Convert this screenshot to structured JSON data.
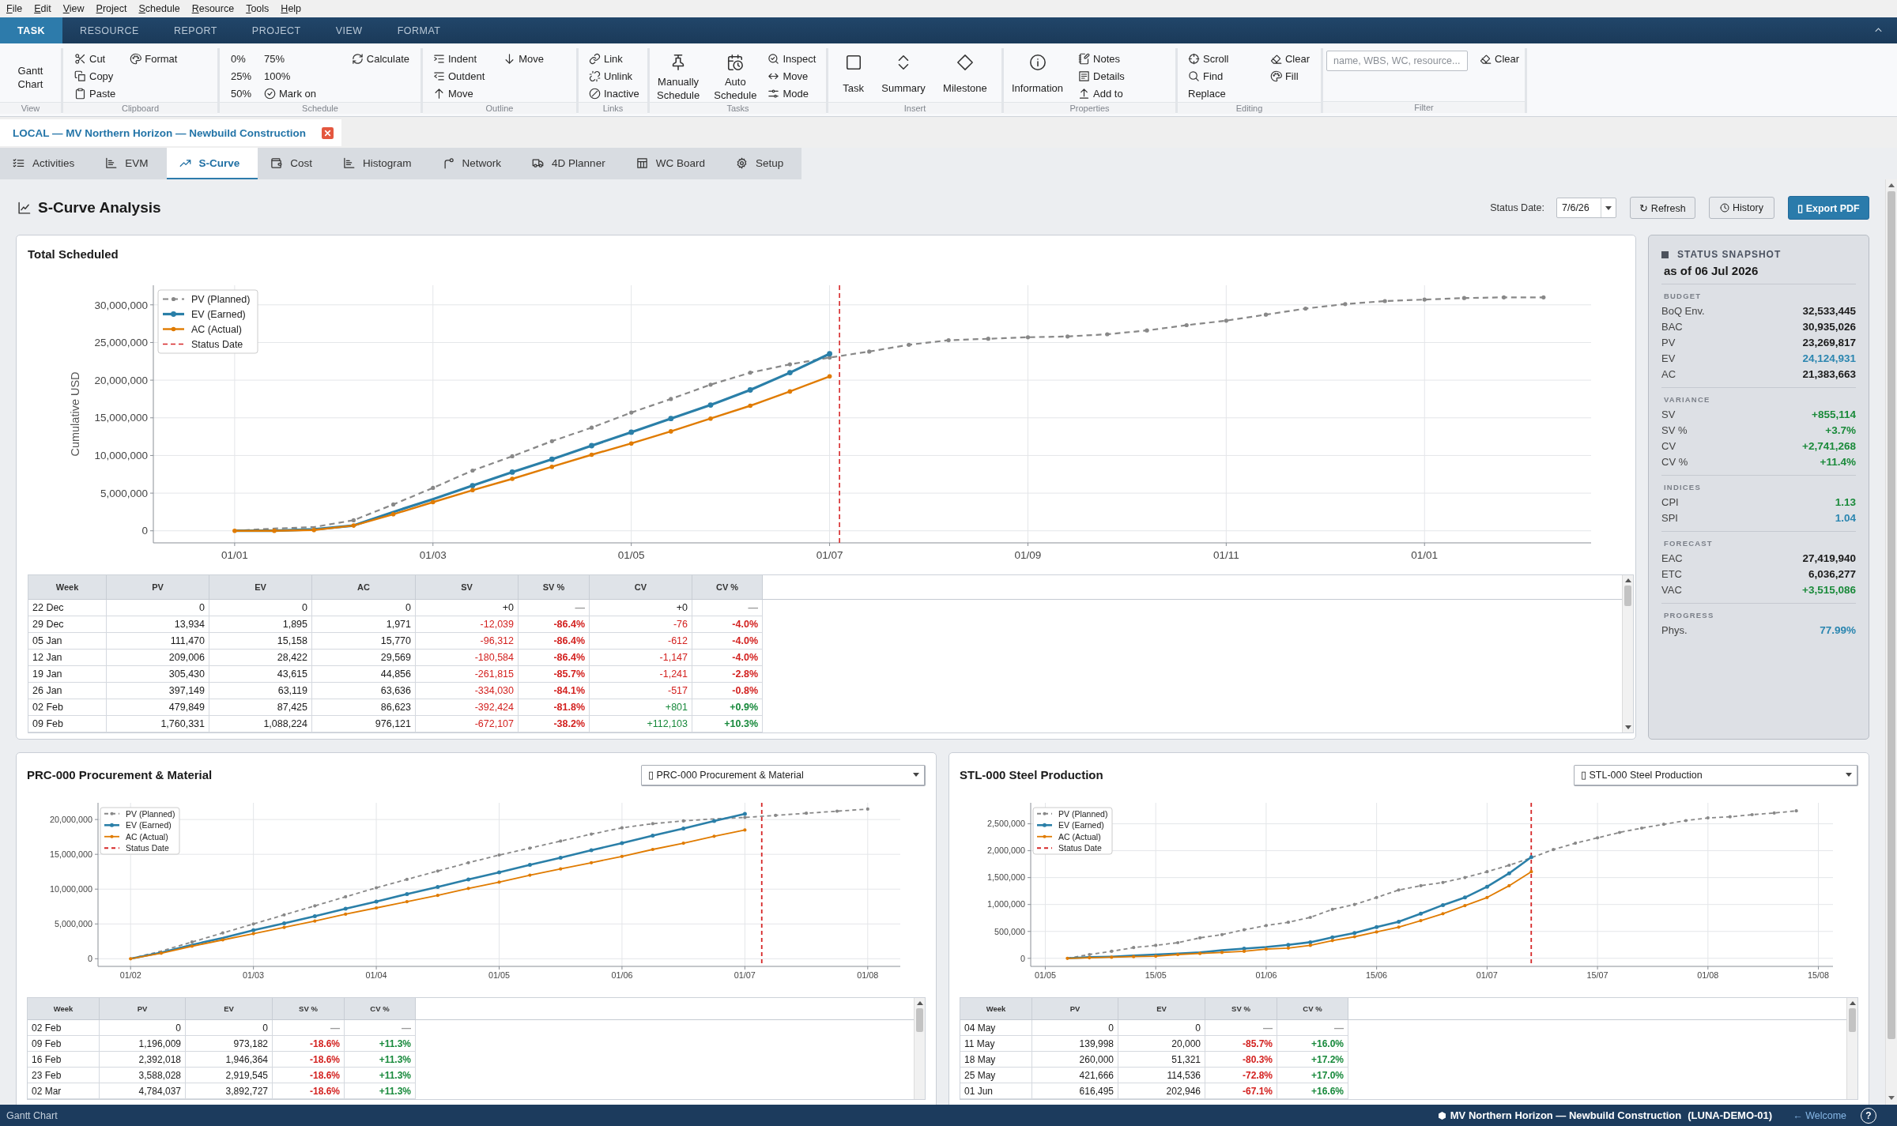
{
  "menu_bar": [
    "File",
    "Edit",
    "View",
    "Project",
    "Schedule",
    "Resource",
    "Tools",
    "Help"
  ],
  "ribbon": {
    "tabs": [
      {
        "label": "TASK",
        "selected": true
      },
      {
        "label": "RESOURCE",
        "selected": false
      },
      {
        "label": "REPORT",
        "selected": false
      },
      {
        "label": "PROJECT",
        "selected": false
      },
      {
        "label": "VIEW",
        "selected": false
      },
      {
        "label": "FORMAT",
        "selected": false
      }
    ],
    "groups": [
      {
        "label": "View",
        "columns": [
          [
            {
              "kind": "large",
              "label": "Gantt Chart"
            }
          ]
        ]
      },
      {
        "label": "Clipboard",
        "columns": [
          [
            {
              "kind": "small",
              "label": "Cut"
            },
            {
              "kind": "small",
              "label": "Copy"
            },
            {
              "kind": "small",
              "label": "Paste"
            }
          ],
          [
            {
              "kind": "small",
              "label": "Format"
            }
          ]
        ]
      },
      {
        "label": "Schedule",
        "columns": [
          [
            {
              "kind": "small",
              "label": "0%"
            },
            {
              "kind": "small",
              "label": "25%"
            },
            {
              "kind": "small",
              "label": "50%"
            }
          ],
          [
            {
              "kind": "small",
              "label": "75%"
            },
            {
              "kind": "small",
              "label": "100%"
            },
            {
              "kind": "small",
              "label": "Mark on"
            }
          ],
          [
            {
              "kind": "small",
              "label": "Calculate"
            }
          ]
        ]
      },
      {
        "label": "Outline",
        "columns": [
          [
            {
              "kind": "small",
              "label": "Indent"
            },
            {
              "kind": "small",
              "label": "Outdent"
            },
            {
              "kind": "small",
              "label": "Move"
            }
          ],
          [
            {
              "kind": "small",
              "label": "Move"
            }
          ]
        ]
      },
      {
        "label": "Links",
        "columns": [
          [
            {
              "kind": "small",
              "label": "Link"
            },
            {
              "kind": "small",
              "label": "Unlink"
            },
            {
              "kind": "small",
              "label": "Inactive"
            }
          ]
        ]
      },
      {
        "label": "Tasks",
        "columns": [
          [
            {
              "kind": "large",
              "label": "Manually Schedule"
            }
          ],
          [
            {
              "kind": "large",
              "label": "Auto Schedule"
            }
          ],
          [
            {
              "kind": "small",
              "label": "Inspect"
            },
            {
              "kind": "small",
              "label": "Move"
            },
            {
              "kind": "small",
              "label": "Mode"
            }
          ]
        ]
      },
      {
        "label": "Insert",
        "columns": [
          [
            {
              "kind": "large",
              "label": "Task"
            }
          ],
          [
            {
              "kind": "large",
              "label": "Summary"
            }
          ],
          [
            {
              "kind": "large",
              "label": "Milestone"
            }
          ]
        ]
      },
      {
        "label": "Properties",
        "columns": [
          [
            {
              "kind": "large",
              "label": "Information"
            }
          ],
          [
            {
              "kind": "small",
              "label": "Notes"
            },
            {
              "kind": "small",
              "label": "Details"
            },
            {
              "kind": "small",
              "label": "Add to"
            }
          ]
        ]
      },
      {
        "label": "Editing",
        "columns": [
          [
            {
              "kind": "small",
              "label": "Scroll"
            },
            {
              "kind": "small",
              "label": "Find"
            },
            {
              "kind": "small",
              "label": "Replace"
            }
          ],
          [
            {
              "kind": "small",
              "label": "Clear"
            },
            {
              "kind": "small",
              "label": "Fill"
            }
          ]
        ]
      },
      {
        "label": "Filter",
        "columns": [
          [
            {
              "kind": "field",
              "placeholder": "name, WBS, WC, resource..."
            }
          ],
          [
            {
              "kind": "small",
              "label": "Clear"
            }
          ]
        ]
      }
    ]
  },
  "document_tab": {
    "title": "LOCAL — MV Northern Horizon — Newbuild Construction"
  },
  "module_tabs": [
    {
      "label": "Activities",
      "selected": false
    },
    {
      "label": "EVM",
      "selected": false
    },
    {
      "label": "S-Curve",
      "selected": true
    },
    {
      "label": "Cost",
      "selected": false
    },
    {
      "label": "Histogram",
      "selected": false
    },
    {
      "label": "Network",
      "selected": false
    },
    {
      "label": "4D Planner",
      "selected": false
    },
    {
      "label": "WC Board",
      "selected": false
    },
    {
      "label": "Setup",
      "selected": false
    }
  ],
  "page_header": {
    "title": "S-Curve Analysis",
    "status_date_label": "Status Date:",
    "status_date": "7/6/26",
    "buttons": [
      {
        "label": "↻ Refresh",
        "kind": "secondary"
      },
      {
        "label": "History",
        "kind": "secondary"
      },
      {
        "label": "▯ Export PDF",
        "kind": "primary"
      }
    ]
  },
  "main_chart": {
    "title": "Total Scheduled",
    "status_line": {
      "label": "Status Date"
    },
    "chart_data": {
      "type": "line",
      "ylabel": "Cumulative USD",
      "categories": [
        "01/01",
        null,
        null,
        null,
        null,
        "01/03",
        null,
        null,
        null,
        null,
        "01/05",
        null,
        null,
        null,
        null,
        "01/07",
        null,
        null,
        null,
        null,
        "01/09",
        null,
        null,
        null,
        null,
        "01/11",
        null,
        null,
        null,
        null,
        "01/01",
        null,
        null,
        null
      ],
      "series": [
        {
          "name": "PV (Planned)",
          "color": "#888888",
          "line_style": "dashed",
          "values": [
            0,
            300000,
            500000,
            1400000,
            3500000,
            5700000,
            8000000,
            9900000,
            11900000,
            13700000,
            15700000,
            17500000,
            19400000,
            21000000,
            22100000,
            23000000,
            23800000,
            24700000,
            25300000,
            25500000,
            25700000,
            25800000,
            26100000,
            26600000,
            27300000,
            27900000,
            28700000,
            29500000,
            30100000,
            30500000,
            30700000,
            30900000,
            31000000,
            31000000
          ]
        },
        {
          "name": "EV (Earned)",
          "color": "#2a7fa8",
          "values": [
            0,
            0,
            200000,
            700000,
            2500000,
            4200000,
            6000000,
            7800000,
            9500000,
            11300000,
            13100000,
            14900000,
            16700000,
            18700000,
            21000000,
            23500000,
            null,
            null,
            null,
            null,
            null,
            null,
            null,
            null,
            null,
            null,
            null,
            null,
            null,
            null,
            null,
            null,
            null,
            null
          ]
        },
        {
          "name": "AC (Actual)",
          "color": "#e07b00",
          "values": [
            0,
            0,
            100000,
            700000,
            2200000,
            3800000,
            5400000,
            6900000,
            8500000,
            10100000,
            11600000,
            13200000,
            14900000,
            16600000,
            18500000,
            20500000,
            null,
            null,
            null,
            null,
            null,
            null,
            null,
            null,
            null,
            null,
            null,
            null,
            null,
            null,
            null,
            null,
            null,
            null
          ]
        }
      ],
      "ylim": [
        -1600000,
        32600000
      ],
      "yticks": [
        {
          "value": 0,
          "label": "0"
        },
        {
          "value": 5000000,
          "label": "5,000,000"
        },
        {
          "value": 10000000,
          "label": "10,000,000"
        },
        {
          "value": 15000000,
          "label": "15,000,000"
        },
        {
          "value": 20000000,
          "label": "20,000,000"
        },
        {
          "value": 25000000,
          "label": "25,000,000"
        },
        {
          "value": 30000000,
          "label": "30,000,000"
        }
      ],
      "grid": true,
      "legend": true
    },
    "table": {
      "columns": [
        {
          "label": "Week",
          "kind": "label"
        },
        {
          "label": "PV",
          "kind": "amount"
        },
        {
          "label": "EV",
          "kind": "amount"
        },
        {
          "label": "AC",
          "kind": "amount"
        },
        {
          "label": "SV",
          "kind": "variance"
        },
        {
          "label": "SV %",
          "kind": "percent"
        },
        {
          "label": "CV",
          "kind": "variance"
        },
        {
          "label": "CV %",
          "kind": "percent"
        }
      ],
      "rows": [
        {
          "cells": [
            {
              "text": "22 Dec",
              "kind": "plain"
            },
            {
              "text": "0",
              "kind": "plain"
            },
            {
              "text": "0",
              "kind": "plain"
            },
            {
              "text": "0",
              "kind": "plain"
            },
            {
              "text": "+0",
              "kind": "neutral"
            },
            {
              "text": "—",
              "kind": "neutral"
            },
            {
              "text": "+0",
              "kind": "neutral"
            },
            {
              "text": "—",
              "kind": "neutral"
            }
          ]
        },
        {
          "cells": [
            {
              "text": "29 Dec",
              "kind": "plain"
            },
            {
              "text": "13,934",
              "kind": "plain"
            },
            {
              "text": "1,895",
              "kind": "plain"
            },
            {
              "text": "1,971",
              "kind": "plain"
            },
            {
              "text": "-12,039",
              "kind": "negative"
            },
            {
              "text": "-86.4%",
              "kind": "negative"
            },
            {
              "text": "-76",
              "kind": "negative"
            },
            {
              "text": "-4.0%",
              "kind": "negative"
            }
          ]
        },
        {
          "cells": [
            {
              "text": "05 Jan",
              "kind": "plain"
            },
            {
              "text": "111,470",
              "kind": "plain"
            },
            {
              "text": "15,158",
              "kind": "plain"
            },
            {
              "text": "15,770",
              "kind": "plain"
            },
            {
              "text": "-96,312",
              "kind": "negative"
            },
            {
              "text": "-86.4%",
              "kind": "negative"
            },
            {
              "text": "-612",
              "kind": "negative"
            },
            {
              "text": "-4.0%",
              "kind": "negative"
            }
          ]
        },
        {
          "cells": [
            {
              "text": "12 Jan",
              "kind": "plain"
            },
            {
              "text": "209,006",
              "kind": "plain"
            },
            {
              "text": "28,422",
              "kind": "plain"
            },
            {
              "text": "29,569",
              "kind": "plain"
            },
            {
              "text": "-180,584",
              "kind": "negative"
            },
            {
              "text": "-86.4%",
              "kind": "negative"
            },
            {
              "text": "-1,147",
              "kind": "negative"
            },
            {
              "text": "-4.0%",
              "kind": "negative"
            }
          ]
        },
        {
          "cells": [
            {
              "text": "19 Jan",
              "kind": "plain"
            },
            {
              "text": "305,430",
              "kind": "plain"
            },
            {
              "text": "43,615",
              "kind": "plain"
            },
            {
              "text": "44,856",
              "kind": "plain"
            },
            {
              "text": "-261,815",
              "kind": "negative"
            },
            {
              "text": "-85.7%",
              "kind": "negative"
            },
            {
              "text": "-1,241",
              "kind": "negative"
            },
            {
              "text": "-2.8%",
              "kind": "negative"
            }
          ]
        },
        {
          "cells": [
            {
              "text": "26 Jan",
              "kind": "plain"
            },
            {
              "text": "397,149",
              "kind": "plain"
            },
            {
              "text": "63,119",
              "kind": "plain"
            },
            {
              "text": "63,636",
              "kind": "plain"
            },
            {
              "text": "-334,030",
              "kind": "negative"
            },
            {
              "text": "-84.1%",
              "kind": "negative"
            },
            {
              "text": "-517",
              "kind": "negative"
            },
            {
              "text": "-0.8%",
              "kind": "negative"
            }
          ]
        },
        {
          "cells": [
            {
              "text": "02 Feb",
              "kind": "plain"
            },
            {
              "text": "479,849",
              "kind": "plain"
            },
            {
              "text": "87,425",
              "kind": "plain"
            },
            {
              "text": "86,623",
              "kind": "plain"
            },
            {
              "text": "-392,424",
              "kind": "negative"
            },
            {
              "text": "-81.8%",
              "kind": "negative"
            },
            {
              "text": "+801",
              "kind": "positive"
            },
            {
              "text": "+0.9%",
              "kind": "positive"
            }
          ]
        },
        {
          "cells": [
            {
              "text": "09 Feb",
              "kind": "plain"
            },
            {
              "text": "1,760,331",
              "kind": "plain"
            },
            {
              "text": "1,088,224",
              "kind": "plain"
            },
            {
              "text": "976,121",
              "kind": "plain"
            },
            {
              "text": "-672,107",
              "kind": "negative"
            },
            {
              "text": "-38.2%",
              "kind": "negative"
            },
            {
              "text": "+112,103",
              "kind": "positive"
            },
            {
              "text": "+10.3%",
              "kind": "positive"
            }
          ]
        }
      ]
    }
  },
  "status_snapshot": {
    "title": "STATUS SNAPSHOT",
    "as_of": "as of 06 Jul 2026",
    "sections": [
      {
        "title": "BUDGET",
        "rows": [
          {
            "label": "BoQ Env.",
            "value": "32,533,445",
            "kind": "plain"
          },
          {
            "label": "BAC",
            "value": "30,935,026",
            "kind": "plain"
          },
          {
            "label": "PV",
            "value": "23,269,817",
            "kind": "plain"
          },
          {
            "label": "EV",
            "value": "24,124,931",
            "kind": "info"
          },
          {
            "label": "AC",
            "value": "21,383,663",
            "kind": "plain"
          }
        ]
      },
      {
        "title": "VARIANCE",
        "rows": [
          {
            "label": "SV",
            "value": "+855,114",
            "kind": "positive"
          },
          {
            "label": "SV %",
            "value": "+3.7%",
            "kind": "positive"
          },
          {
            "label": "CV",
            "value": "+2,741,268",
            "kind": "positive"
          },
          {
            "label": "CV %",
            "value": "+11.4%",
            "kind": "positive"
          }
        ]
      },
      {
        "title": "INDICES",
        "rows": [
          {
            "label": "CPI",
            "value": "1.13",
            "kind": "positive"
          },
          {
            "label": "SPI",
            "value": "1.04",
            "kind": "info"
          }
        ]
      },
      {
        "title": "FORECAST",
        "rows": [
          {
            "label": "EAC",
            "value": "27,419,940",
            "kind": "plain"
          },
          {
            "label": "ETC",
            "value": "6,036,277",
            "kind": "plain"
          },
          {
            "label": "VAC",
            "value": "+3,515,086",
            "kind": "positive"
          }
        ]
      },
      {
        "title": "PROGRESS",
        "rows": [
          {
            "label": "Phys.",
            "value": "77.99%",
            "kind": "info"
          }
        ]
      }
    ]
  },
  "wbs_panels": [
    {
      "title": "PRC-000 Procurement & Material",
      "selector": "▯ PRC-000 Procurement & Material",
      "status_line": {
        "label": "Status Date"
      },
      "chart_data": {
        "type": "line",
        "categories": [
          "01/02",
          null,
          null,
          null,
          "01/03",
          null,
          null,
          null,
          "01/04",
          null,
          null,
          null,
          "01/05",
          null,
          null,
          null,
          "01/06",
          null,
          null,
          null,
          "01/07",
          null,
          null,
          null,
          "01/08"
        ],
        "series": [
          {
            "name": "PV (Planned)",
            "color": "#888888",
            "line_style": "dashed",
            "values": [
              0,
              1100000,
              2400000,
              3700000,
              5000000,
              6300000,
              7600000,
              8900000,
              10200000,
              11400000,
              12600000,
              13800000,
              14900000,
              15900000,
              16900000,
              17900000,
              18800000,
              19400000,
              19800000,
              20100000,
              20300000,
              20600000,
              20900000,
              21200000,
              21500000
            ]
          },
          {
            "name": "EV (Earned)",
            "color": "#2a7fa8",
            "values": [
              0,
              900000,
              2000000,
              3000000,
              4100000,
              5100000,
              6100000,
              7200000,
              8200000,
              9300000,
              10300000,
              11400000,
              12400000,
              13500000,
              14500000,
              15600000,
              16600000,
              17700000,
              18700000,
              19800000,
              20800000,
              null,
              null,
              null,
              null
            ]
          },
          {
            "name": "AC (Actual)",
            "color": "#e07b00",
            "values": [
              0,
              800000,
              1800000,
              2700000,
              3600000,
              4500000,
              5400000,
              6400000,
              7300000,
              8200000,
              9100000,
              10100000,
              11000000,
              12000000,
              12900000,
              13800000,
              14700000,
              15700000,
              16600000,
              17600000,
              18500000,
              null,
              null,
              null,
              null
            ]
          }
        ],
        "ylim": [
          -1100000,
          22400000
        ],
        "yticks": [
          {
            "value": 0,
            "label": "0"
          },
          {
            "value": 5000000,
            "label": "5,000,000"
          },
          {
            "value": 10000000,
            "label": "10,000,000"
          },
          {
            "value": 15000000,
            "label": "15,000,000"
          },
          {
            "value": 20000000,
            "label": "20,000,000"
          }
        ],
        "grid": true,
        "legend": true
      },
      "table": {
        "columns": [
          {
            "label": "Week",
            "kind": "label"
          },
          {
            "label": "PV",
            "kind": "amount"
          },
          {
            "label": "EV",
            "kind": "amount"
          },
          {
            "label": "SV %",
            "kind": "percent"
          },
          {
            "label": "CV %",
            "kind": "percent"
          }
        ],
        "rows": [
          {
            "cells": [
              {
                "text": "02 Feb",
                "kind": "plain"
              },
              {
                "text": "0",
                "kind": "plain"
              },
              {
                "text": "0",
                "kind": "plain"
              },
              {
                "text": "—",
                "kind": "neutral"
              },
              {
                "text": "—",
                "kind": "neutral"
              }
            ]
          },
          {
            "cells": [
              {
                "text": "09 Feb",
                "kind": "plain"
              },
              {
                "text": "1,196,009",
                "kind": "plain"
              },
              {
                "text": "973,182",
                "kind": "plain"
              },
              {
                "text": "-18.6%",
                "kind": "negative"
              },
              {
                "text": "+11.3%",
                "kind": "positive"
              }
            ]
          },
          {
            "cells": [
              {
                "text": "16 Feb",
                "kind": "plain"
              },
              {
                "text": "2,392,018",
                "kind": "plain"
              },
              {
                "text": "1,946,364",
                "kind": "plain"
              },
              {
                "text": "-18.6%",
                "kind": "negative"
              },
              {
                "text": "+11.3%",
                "kind": "positive"
              }
            ]
          },
          {
            "cells": [
              {
                "text": "23 Feb",
                "kind": "plain"
              },
              {
                "text": "3,588,028",
                "kind": "plain"
              },
              {
                "text": "2,919,545",
                "kind": "plain"
              },
              {
                "text": "-18.6%",
                "kind": "negative"
              },
              {
                "text": "+11.3%",
                "kind": "positive"
              }
            ]
          },
          {
            "cells": [
              {
                "text": "02 Mar",
                "kind": "plain"
              },
              {
                "text": "4,784,037",
                "kind": "plain"
              },
              {
                "text": "3,892,727",
                "kind": "plain"
              },
              {
                "text": "-18.6%",
                "kind": "negative"
              },
              {
                "text": "+11.3%",
                "kind": "positive"
              }
            ]
          }
        ]
      }
    },
    {
      "title": "STL-000 Steel Production",
      "selector": "▯ STL-000 Steel Production",
      "status_line": {
        "label": "Status Date"
      },
      "chart_data": {
        "type": "line",
        "categories": [
          "01/05",
          null,
          null,
          null,
          null,
          "15/05",
          null,
          null,
          null,
          null,
          "01/06",
          null,
          null,
          null,
          null,
          "15/06",
          null,
          null,
          null,
          null,
          "01/07",
          null,
          null,
          null,
          null,
          "15/07",
          null,
          null,
          null,
          null,
          "01/08",
          null,
          null,
          null,
          null,
          "15/08"
        ],
        "series": [
          {
            "name": "PV (Planned)",
            "color": "#888888",
            "line_style": "dashed",
            "values": [
              null,
              0,
              70000,
              130000,
              200000,
              240000,
              290000,
              380000,
              440000,
              530000,
              610000,
              670000,
              760000,
              910000,
              1000000,
              1130000,
              1270000,
              1350000,
              1410000,
              1500000,
              1610000,
              1730000,
              1870000,
              2020000,
              2140000,
              2240000,
              2340000,
              2420000,
              2490000,
              2560000,
              2610000,
              2630000,
              2670000,
              2700000,
              2740000,
              null
            ]
          },
          {
            "name": "EV (Earned)",
            "color": "#2a7fa8",
            "values": [
              null,
              0,
              20000,
              30000,
              50000,
              70000,
              90000,
              110000,
              150000,
              180000,
              210000,
              250000,
              300000,
              390000,
              470000,
              580000,
              680000,
              830000,
              990000,
              1130000,
              1330000,
              1580000,
              1880000,
              null,
              null,
              null,
              null,
              null,
              null,
              null,
              null,
              null,
              null,
              null,
              null,
              null
            ]
          },
          {
            "name": "AC (Actual)",
            "color": "#e07b00",
            "values": [
              null,
              0,
              10000,
              20000,
              30000,
              40000,
              70000,
              90000,
              110000,
              130000,
              170000,
              190000,
              240000,
              330000,
              400000,
              490000,
              580000,
              700000,
              830000,
              980000,
              1130000,
              1350000,
              1610000,
              null,
              null,
              null,
              null,
              null,
              null,
              null,
              null,
              null,
              null,
              null,
              null,
              null
            ]
          }
        ],
        "ylim": [
          -150000,
          2890000
        ],
        "yticks": [
          {
            "value": 0,
            "label": "0"
          },
          {
            "value": 500000,
            "label": "500,000"
          },
          {
            "value": 1000000,
            "label": "1,000,000"
          },
          {
            "value": 1500000,
            "label": "1,500,000"
          },
          {
            "value": 2000000,
            "label": "2,000,000"
          },
          {
            "value": 2500000,
            "label": "2,500,000"
          }
        ],
        "grid": true,
        "legend": true
      },
      "table": {
        "columns": [
          {
            "label": "Week",
            "kind": "label"
          },
          {
            "label": "PV",
            "kind": "amount"
          },
          {
            "label": "EV",
            "kind": "amount"
          },
          {
            "label": "SV %",
            "kind": "percent"
          },
          {
            "label": "CV %",
            "kind": "percent"
          }
        ],
        "rows": [
          {
            "cells": [
              {
                "text": "04 May",
                "kind": "plain"
              },
              {
                "text": "0",
                "kind": "plain"
              },
              {
                "text": "0",
                "kind": "plain"
              },
              {
                "text": "—",
                "kind": "neutral"
              },
              {
                "text": "—",
                "kind": "neutral"
              }
            ]
          },
          {
            "cells": [
              {
                "text": "11 May",
                "kind": "plain"
              },
              {
                "text": "139,998",
                "kind": "plain"
              },
              {
                "text": "20,000",
                "kind": "plain"
              },
              {
                "text": "-85.7%",
                "kind": "negative"
              },
              {
                "text": "+16.0%",
                "kind": "positive"
              }
            ]
          },
          {
            "cells": [
              {
                "text": "18 May",
                "kind": "plain"
              },
              {
                "text": "260,000",
                "kind": "plain"
              },
              {
                "text": "51,321",
                "kind": "plain"
              },
              {
                "text": "-80.3%",
                "kind": "negative"
              },
              {
                "text": "+17.2%",
                "kind": "positive"
              }
            ]
          },
          {
            "cells": [
              {
                "text": "25 May",
                "kind": "plain"
              },
              {
                "text": "421,666",
                "kind": "plain"
              },
              {
                "text": "114,536",
                "kind": "plain"
              },
              {
                "text": "-72.8%",
                "kind": "negative"
              },
              {
                "text": "+17.0%",
                "kind": "positive"
              }
            ]
          },
          {
            "cells": [
              {
                "text": "01 Jun",
                "kind": "plain"
              },
              {
                "text": "616,495",
                "kind": "plain"
              },
              {
                "text": "202,946",
                "kind": "plain"
              },
              {
                "text": "-67.1%",
                "kind": "negative"
              },
              {
                "text": "+16.6%",
                "kind": "positive"
              }
            ]
          }
        ]
      }
    }
  ],
  "status_bar": {
    "mode": "Gantt Chart",
    "project": "MV Northern Horizon — Newbuild Construction",
    "project_code": "(LUNA-DEMO-01)",
    "welcome_link": "← Welcome",
    "help": "?"
  }
}
